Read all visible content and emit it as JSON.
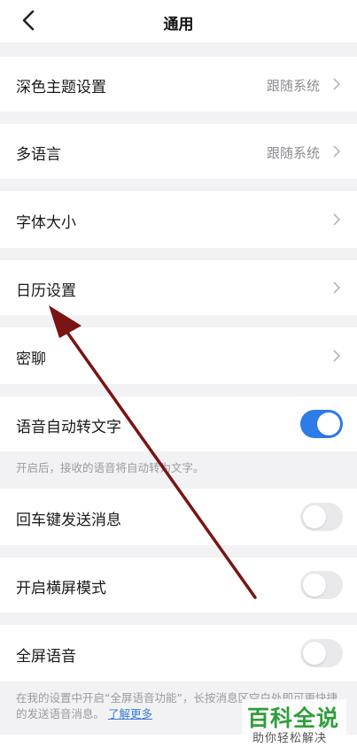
{
  "header": {
    "title": "通用",
    "back_icon": "chevron-left-icon"
  },
  "settings": {
    "dark_theme": {
      "label": "深色主题设置",
      "value": "跟随系统"
    },
    "language": {
      "label": "多语言",
      "value": "跟随系统"
    },
    "font_size": {
      "label": "字体大小"
    },
    "calendar": {
      "label": "日历设置"
    },
    "secret_chat": {
      "label": "密聊"
    },
    "voice_to_text": {
      "label": "语音自动转文字",
      "enabled": true,
      "hint": "开启后，接收的语音将自动转为文字。"
    },
    "enter_send": {
      "label": "回车键发送消息",
      "enabled": false
    },
    "landscape": {
      "label": "开启横屏模式",
      "enabled": false
    },
    "fullscreen_voice": {
      "label": "全屏语音",
      "enabled": false,
      "hint": "在我的设置中开启“全屏语音功能”，长按消息区空白处即可更快捷的发送语音消息。",
      "link": "了解更多"
    }
  },
  "colors": {
    "accent": "#2f7ce6",
    "annotation_arrow": "#7a1414",
    "watermark": "#2e9e3a"
  },
  "watermark": {
    "title": "百科全说",
    "subtitle": "助你轻松解决"
  }
}
